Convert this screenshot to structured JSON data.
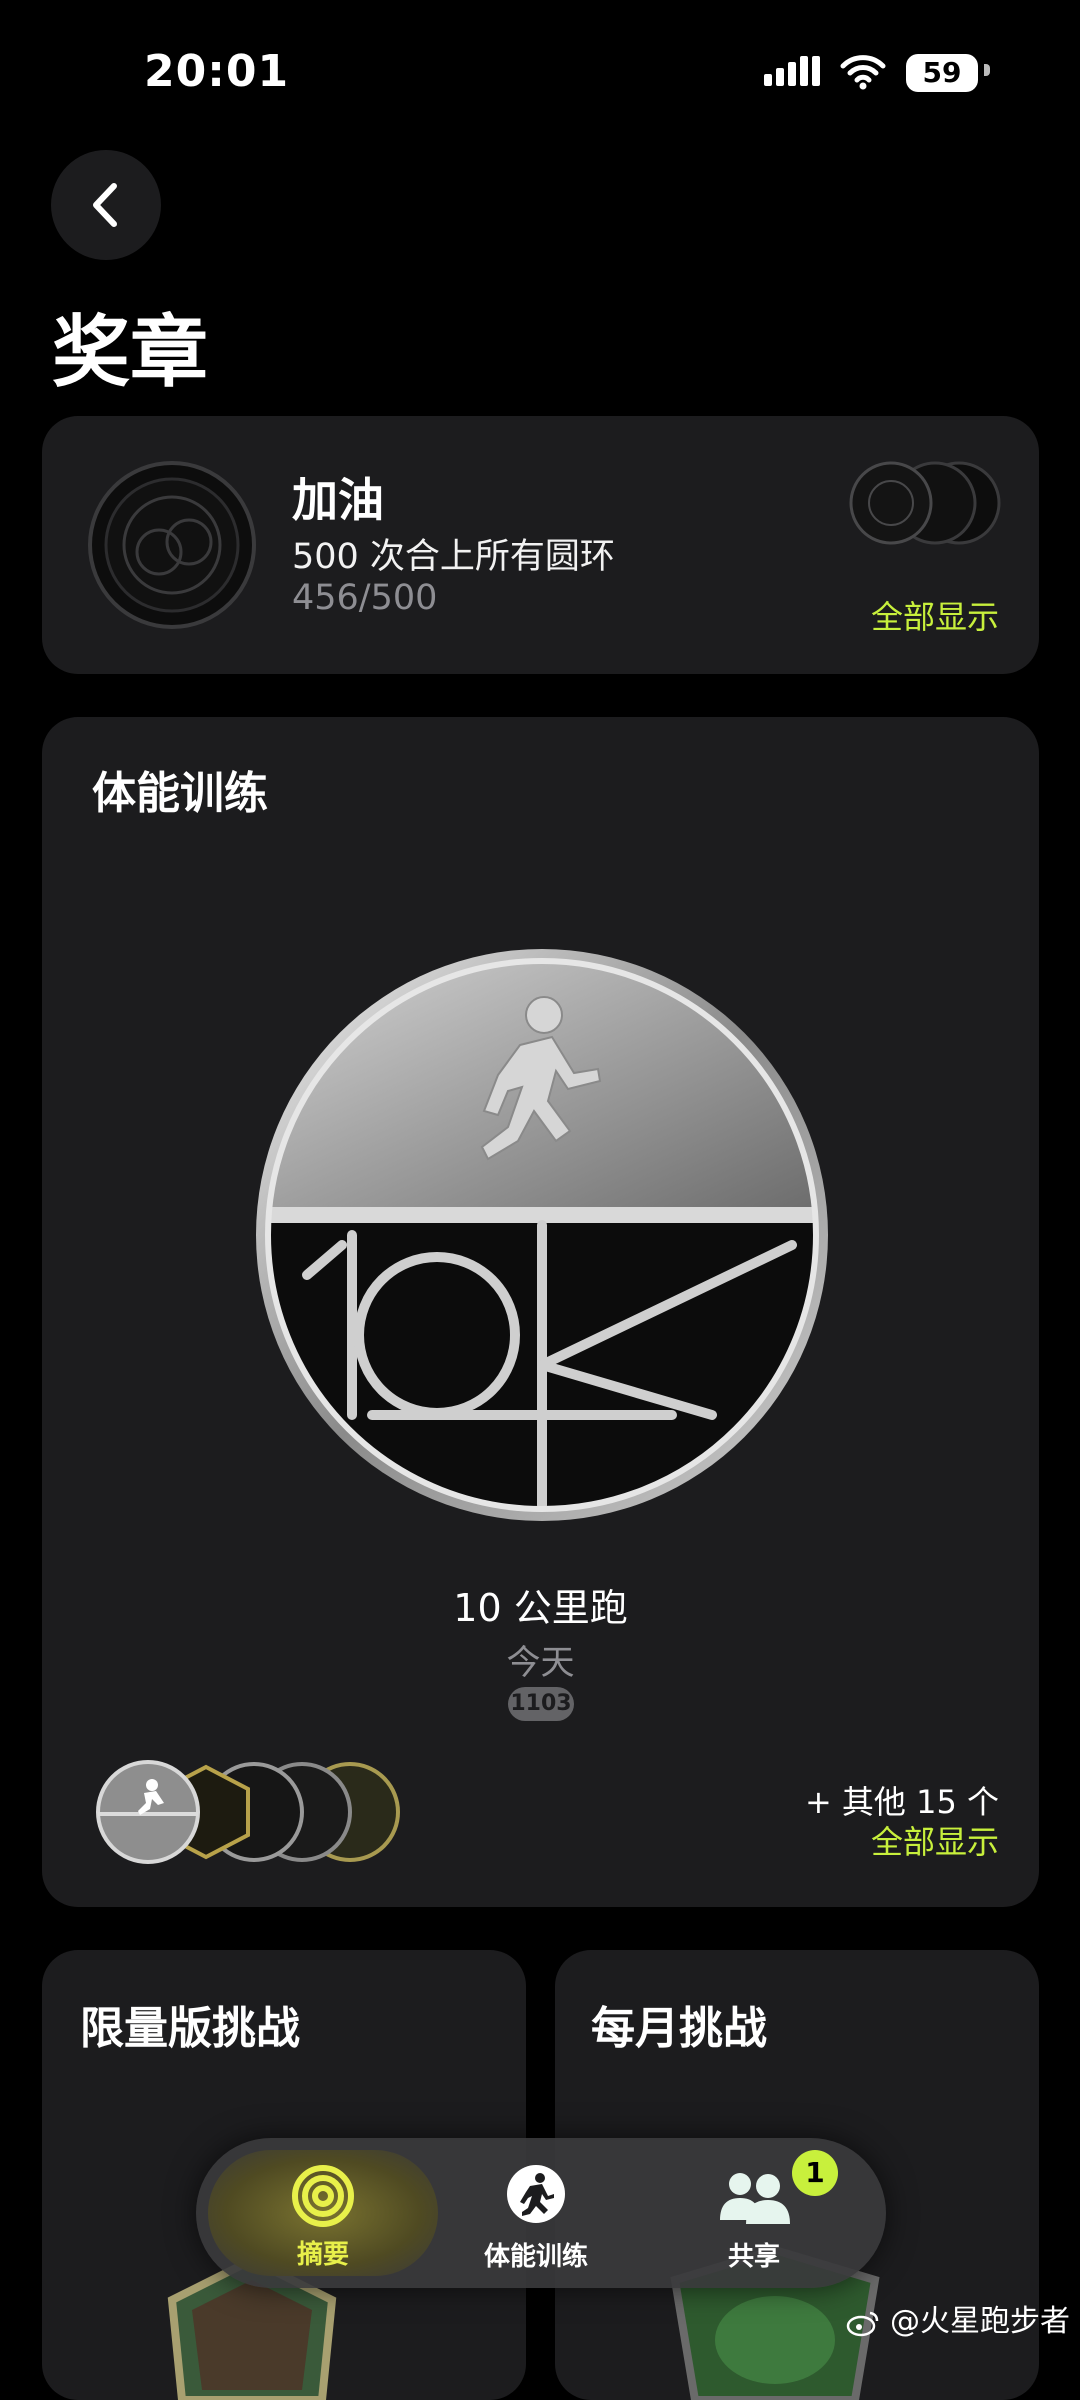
{
  "status_bar": {
    "time": "20:01",
    "battery": "59"
  },
  "page": {
    "title": "奖章"
  },
  "featured": {
    "title": "加油",
    "description": "500 次合上所有圆环",
    "progress": "456/500",
    "show_all": "全部显示"
  },
  "fitness": {
    "section_title": "体能训练",
    "medal_name": "10 公里跑",
    "medal_date": "今天",
    "medal_count": "1103",
    "more_text": "+ 其他 15 个",
    "show_all": "全部显示"
  },
  "limited": {
    "section_title": "限量版挑战"
  },
  "monthly": {
    "section_title": "每月挑战"
  },
  "tab_bar": {
    "tabs": [
      {
        "label": "摘要",
        "icon": "activity-rings-icon",
        "active": true
      },
      {
        "label": "体能训练",
        "icon": "running-figure-icon",
        "active": false
      },
      {
        "label": "共享",
        "icon": "people-icon",
        "active": false,
        "badge": "1"
      }
    ]
  },
  "watermark": "@火星跑步者",
  "colors": {
    "accent": "#c8f03c",
    "card": "#1c1c1e",
    "background": "#000000",
    "secondary_text": "#8e8e93"
  }
}
